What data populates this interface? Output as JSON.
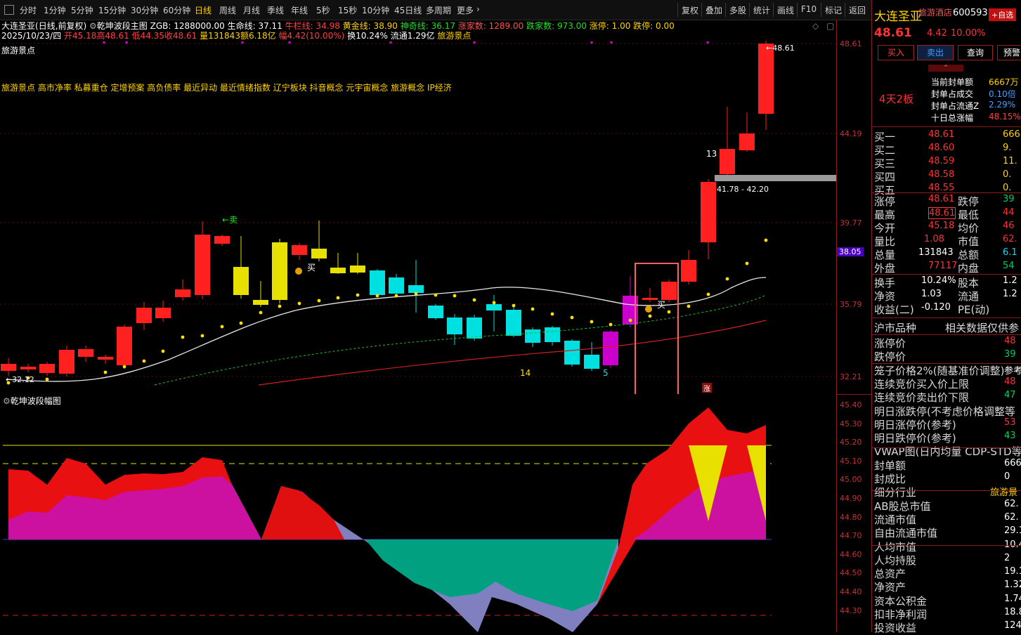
{
  "toolbar": {
    "periods": [
      "分时",
      "1分钟",
      "5分钟",
      "15分钟",
      "30分钟",
      "60分钟",
      "日线",
      "周线",
      "月线",
      "季线",
      "年线",
      "5秒",
      "15秒",
      "10分钟",
      "45日线",
      "多周期",
      "更多"
    ],
    "active": "日线",
    "right": [
      "复权",
      "叠加",
      "多股",
      "统计",
      "画线",
      "F10",
      "标记",
      "返回"
    ]
  },
  "info": {
    "stock_name": "大连圣亚",
    "mode": "(日线,前复权)",
    "indicator": "乾坤波段主图",
    "zgb": "ZGB: 1288000.00",
    "shengming": "生命线: 37.11",
    "niulan": "牛栏线: 34.98",
    "huangjin": "黄金线: 38.90",
    "shenqi": "神奇线: 36.17",
    "zhangjia": "涨家数: 1289.00",
    "diejia": "跌家数: 973.00",
    "zhangting": "涨停: 1.00",
    "dieting": "跌停: 0.00",
    "date": "2025/10/23/四",
    "open": "开45.18",
    "high": "高48.61",
    "low": "低44.35",
    "close": "收48.61",
    "volume": "量131843",
    "amount": "额6.18亿",
    "amplitude": "幅4.42(10.00%)",
    "turnover": "换10.24%",
    "float_cap": "流通1.29亿",
    "concept_tag": "旅游景点",
    "sector_line1": "旅游景点",
    "sector_line2": "旅游景点 高市净率 私募重仓 定增预案 高负债率 最近异动 最近情绪指数 辽宁板块 抖音概念 元宇宙概念 旅游概念 IP经济"
  },
  "annotations": {
    "sell": "←卖",
    "buy": "买",
    "low_label": "←32.12",
    "high_label": "←48.61",
    "count13": "13",
    "count14": "14",
    "count5": "5",
    "zone": "41.78 - 42.20",
    "zhang": "涨",
    "sub_title": "乾坤波段幅图"
  },
  "axis_main": [
    "48.61",
    "44.19",
    "39.77",
    "38.05",
    "35.79",
    "32.21"
  ],
  "axis_sub": [
    "45.40",
    "45.30",
    "45.20",
    "45.10",
    "45.00",
    "44.90",
    "44.80",
    "44.70",
    "44.60",
    "44.50",
    "44.40",
    "44.30"
  ],
  "panel": {
    "name": "大连圣亚",
    "tag": "旅游酒店",
    "code": "600593",
    "self_select": "+自选",
    "price": "48.61",
    "change": "4.42",
    "change_pct": "10.00%",
    "buttons": [
      "买入",
      "卖出",
      "查询",
      "预警"
    ],
    "board_days": "4天2板",
    "seal_rows": [
      {
        "label": "当前封单额",
        "value": "6667万"
      },
      {
        "label": "封单占成交",
        "value": "0.10倍"
      },
      {
        "label": "封单占流通Z",
        "value": "2.29%"
      },
      {
        "label": "十日总涨幅",
        "value": "48.15%"
      }
    ],
    "bids": [
      {
        "label": "买一",
        "price": "48.61",
        "vol": "666"
      },
      {
        "label": "买二",
        "price": "48.60",
        "vol": "9."
      },
      {
        "label": "买三",
        "price": "48.59",
        "vol": "11."
      },
      {
        "label": "买四",
        "price": "48.58",
        "vol": "0."
      },
      {
        "label": "买五",
        "price": "48.55",
        "vol": "0."
      }
    ],
    "stats": [
      {
        "l1": "涨停",
        "v1": "48.61",
        "l2": "跌停",
        "v2": "39"
      },
      {
        "l1": "最高",
        "v1": "48.61",
        "l2": "最低",
        "v2": "44"
      },
      {
        "l1": "今开",
        "v1": "45.18",
        "l2": "均价",
        "v2": "46"
      },
      {
        "l1": "量比",
        "v1": "1.08",
        "l2": "市值",
        "v2": "62."
      },
      {
        "l1": "总量",
        "v1": "131843",
        "l2": "总额",
        "v2": "6.1"
      },
      {
        "l1": "外盘",
        "v1": "77117",
        "l2": "内盘",
        "v2": "54"
      }
    ],
    "stats2": [
      {
        "l1": "换手",
        "v1": "10.24%",
        "l2": "股本",
        "v2": "1.2"
      },
      {
        "l1": "净资",
        "v1": "1.03",
        "l2": "流通",
        "v2": "1.2"
      },
      {
        "l1": "收益(二)",
        "v1": "-0.120",
        "l2": "PE(动)",
        "v2": ""
      }
    ],
    "market": "沪市品种",
    "related": "相关数据仅供参",
    "limit_rows": [
      {
        "label": "涨停价",
        "value": "48"
      },
      {
        "label": "跌停价",
        "value": "39"
      },
      {
        "label": "笼子价格2%(随基准价调整)",
        "value": "参考"
      },
      {
        "label": "连续竞价买入价上限",
        "value": "48"
      },
      {
        "label": "连续竞价卖出价下限",
        "value": "47"
      },
      {
        "label": "明日涨跌停(不考虑价格调整等",
        "value": ""
      },
      {
        "label": "明日涨停价(参考)",
        "value": "53"
      },
      {
        "label": "明日跌停价(参考)",
        "value": "43"
      },
      {
        "label": "VWAP图(日内均量 CDP-STD等)",
        "value": ""
      },
      {
        "label": "封单额",
        "value": "666"
      },
      {
        "label": "封成比",
        "value": "0"
      },
      {
        "label": "细分行业",
        "value": "旅游景"
      },
      {
        "label": "AB股总市值",
        "value": "62."
      },
      {
        "label": "流通市值",
        "value": "62."
      },
      {
        "label": "自由流通市值",
        "value": "29.1"
      },
      {
        "label": "人均市值",
        "value": "10.4"
      },
      {
        "label": "人均持股",
        "value": "2"
      },
      {
        "label": "总资产",
        "value": "19.12"
      },
      {
        "label": "净资产",
        "value": "1.32"
      },
      {
        "label": "资本公积金",
        "value": "1.74"
      },
      {
        "label": "扣非净利润",
        "value": "18.8"
      },
      {
        "label": "投资收益",
        "value": "124"
      }
    ]
  },
  "colors": {
    "up": "#ff2020",
    "down": "#00e0e0",
    "yellow": "#e8e000",
    "magenta": "#cc00cc",
    "text": "#c8c8c8"
  }
}
